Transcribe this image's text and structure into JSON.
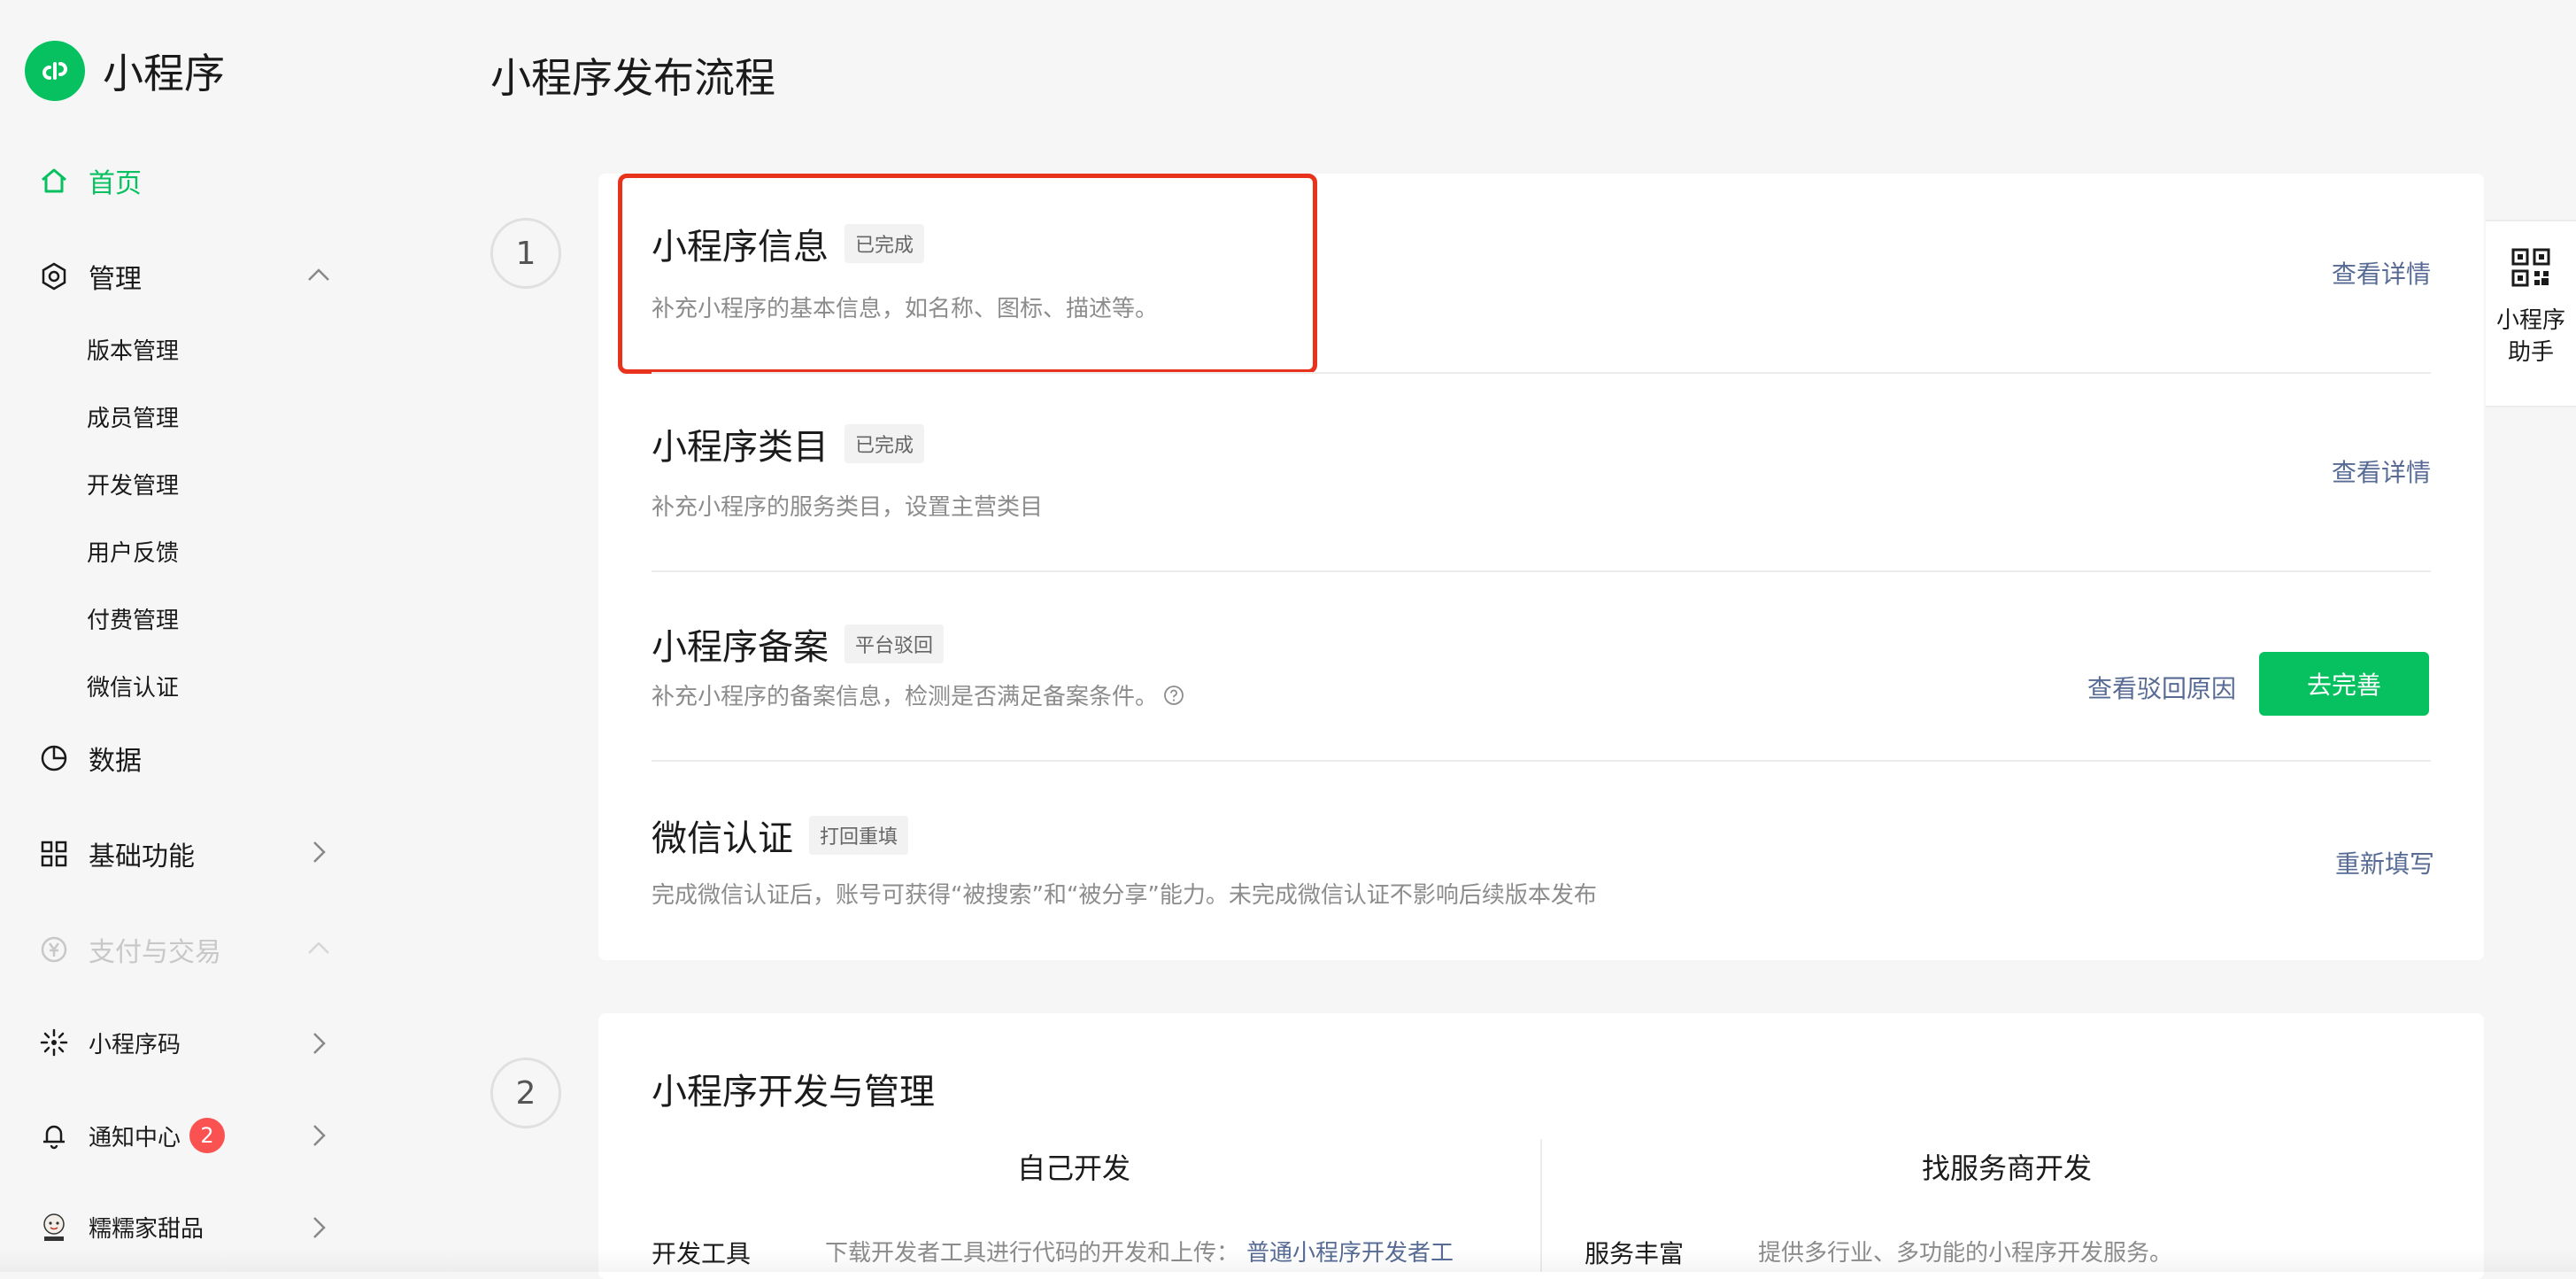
{
  "app": {
    "name": "小程序"
  },
  "sidebar": {
    "home": "首页",
    "manage": "管理",
    "manage_items": [
      "版本管理",
      "成员管理",
      "开发管理",
      "用户反馈",
      "付费管理",
      "微信认证"
    ],
    "data": "数据",
    "basic": "基础功能",
    "payment": "支付与交易",
    "qrcode": "小程序码",
    "notify": "通知中心",
    "notify_count": "2",
    "account": "糯糯家甜品"
  },
  "page": {
    "title": "小程序发布流程"
  },
  "step1": {
    "number": "1",
    "rows": [
      {
        "title": "小程序信息",
        "status": "已完成",
        "desc": "补充小程序的基本信息，如名称、图标、描述等。",
        "action": "查看详情"
      },
      {
        "title": "小程序类目",
        "status": "已完成",
        "desc": "补充小程序的服务类目，设置主营类目",
        "action": "查看详情"
      },
      {
        "title": "小程序备案",
        "status": "平台驳回",
        "desc": "补充小程序的备案信息，检测是否满足备案条件。",
        "action": "查看驳回原因",
        "button": "去完善"
      },
      {
        "title": "微信认证",
        "status": "打回重填",
        "desc": "完成微信认证后，账号可获得“被搜索”和“被分享”能力。未完成微信认证不影响后续版本发布",
        "action": "重新填写"
      }
    ]
  },
  "step2": {
    "number": "2",
    "title": "小程序开发与管理",
    "left": {
      "title": "自己开发",
      "label": "开发工具",
      "desc": "下载开发者工具进行代码的开发和上传：",
      "link": "普通小程序开发者工"
    },
    "right": {
      "title": "找服务商开发",
      "label": "服务丰富",
      "desc": "提供多行业、多功能的小程序开发服务。"
    }
  },
  "helper": {
    "line1": "小程序",
    "line2": "助手"
  },
  "colors": {
    "brand": "#07c160",
    "link": "#576b95",
    "highlight": "#e8321c",
    "badge": "#fa5151"
  }
}
